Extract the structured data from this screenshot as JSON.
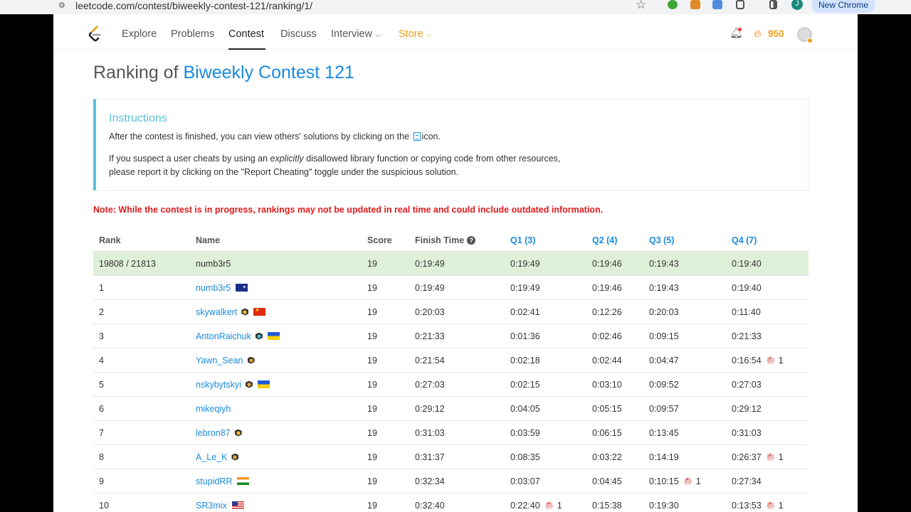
{
  "browser": {
    "url": "leetcode.com/contest/biweekly-contest-121/ranking/1/",
    "profile_initial": "J",
    "new_chrome_label": "New Chrome"
  },
  "nav": {
    "items": [
      "Explore",
      "Problems",
      "Contest",
      "Discuss",
      "Interview",
      "Store"
    ],
    "active": "Contest",
    "coins": "950"
  },
  "title": {
    "prefix": "Ranking of ",
    "contest": "Biweekly Contest 121"
  },
  "instructions": {
    "heading": "Instructions",
    "line1_before": "After the contest is finished, you can view others' solutions by clicking on the",
    "line1_after": "icon.",
    "line2_before": "If you suspect a user cheats by using an ",
    "line2_em": "explicitly",
    "line2_after": " disallowed library function or copying code from other resources,",
    "line3": "please report it by clicking on the \"Report Cheating\" toggle under the suspicious solution."
  },
  "note": "Note: While the contest is in progress, rankings may not be updated in real time and could include outdated information.",
  "table": {
    "headers": {
      "rank": "Rank",
      "name": "Name",
      "score": "Score",
      "finish": "Finish Time",
      "q1": "Q1 (3)",
      "q2": "Q2 (4)",
      "q3": "Q3 (5)",
      "q4": "Q4 (7)"
    },
    "me": {
      "rank": "19808 / 21813",
      "name": "numb3r5",
      "score": "19",
      "finish": "0:19:49",
      "q1": "0:19:49",
      "q2": "0:19:46",
      "q3": "0:19:43",
      "q4": "0:19:40"
    },
    "rows": [
      {
        "rank": "1",
        "name": "numb3r5",
        "score": "19",
        "finish": "0:19:49",
        "q1": "0:19:49",
        "q2": "0:19:46",
        "q3": "0:19:43",
        "q4": "0:19:40",
        "q4_bugs": ""
      },
      {
        "rank": "2",
        "name": "skywalkert",
        "score": "19",
        "finish": "0:20:03",
        "q1": "0:02:41",
        "q2": "0:12:26",
        "q3": "0:20:03",
        "q4": "0:11:40",
        "q4_bugs": ""
      },
      {
        "rank": "3",
        "name": "AntonRaichuk",
        "score": "19",
        "finish": "0:21:33",
        "q1": "0:01:36",
        "q2": "0:02:46",
        "q3": "0:09:15",
        "q4": "0:21:33",
        "q4_bugs": ""
      },
      {
        "rank": "4",
        "name": "Yawn_Sean",
        "score": "19",
        "finish": "0:21:54",
        "q1": "0:02:18",
        "q2": "0:02:44",
        "q3": "0:04:47",
        "q4": "0:16:54",
        "q4_bugs": "1"
      },
      {
        "rank": "5",
        "name": "nskybytskyi",
        "score": "19",
        "finish": "0:27:03",
        "q1": "0:02:15",
        "q2": "0:03:10",
        "q3": "0:09:52",
        "q4": "0:27:03",
        "q4_bugs": ""
      },
      {
        "rank": "6",
        "name": "mikeqiyh",
        "score": "19",
        "finish": "0:29:12",
        "q1": "0:04:05",
        "q2": "0:05:15",
        "q3": "0:09:57",
        "q4": "0:29:12",
        "q4_bugs": ""
      },
      {
        "rank": "7",
        "name": "lebron87",
        "score": "19",
        "finish": "0:31:03",
        "q1": "0:03:59",
        "q2": "0:06:15",
        "q3": "0:13:45",
        "q4": "0:31:03",
        "q4_bugs": ""
      },
      {
        "rank": "8",
        "name": "A_Le_K",
        "score": "19",
        "finish": "0:31:37",
        "q1": "0:08:35",
        "q2": "0:03:22",
        "q3": "0:14:19",
        "q4": "0:26:37",
        "q4_bugs": "1"
      },
      {
        "rank": "9",
        "name": "stupidRR",
        "score": "19",
        "finish": "0:32:34",
        "q1": "0:03:07",
        "q2": "0:04:45",
        "q3": "0:10:15",
        "q3_bugs": "1",
        "q4": "0:27:34",
        "q4_bugs": ""
      },
      {
        "rank": "10",
        "name": "SR3mix",
        "score": "19",
        "finish": "0:32:40",
        "q1": "0:22:40",
        "q1_bugs": "1",
        "q2": "0:15:38",
        "q3": "0:19:30",
        "q4": "0:13:53",
        "q4_bugs": "1"
      }
    ]
  }
}
